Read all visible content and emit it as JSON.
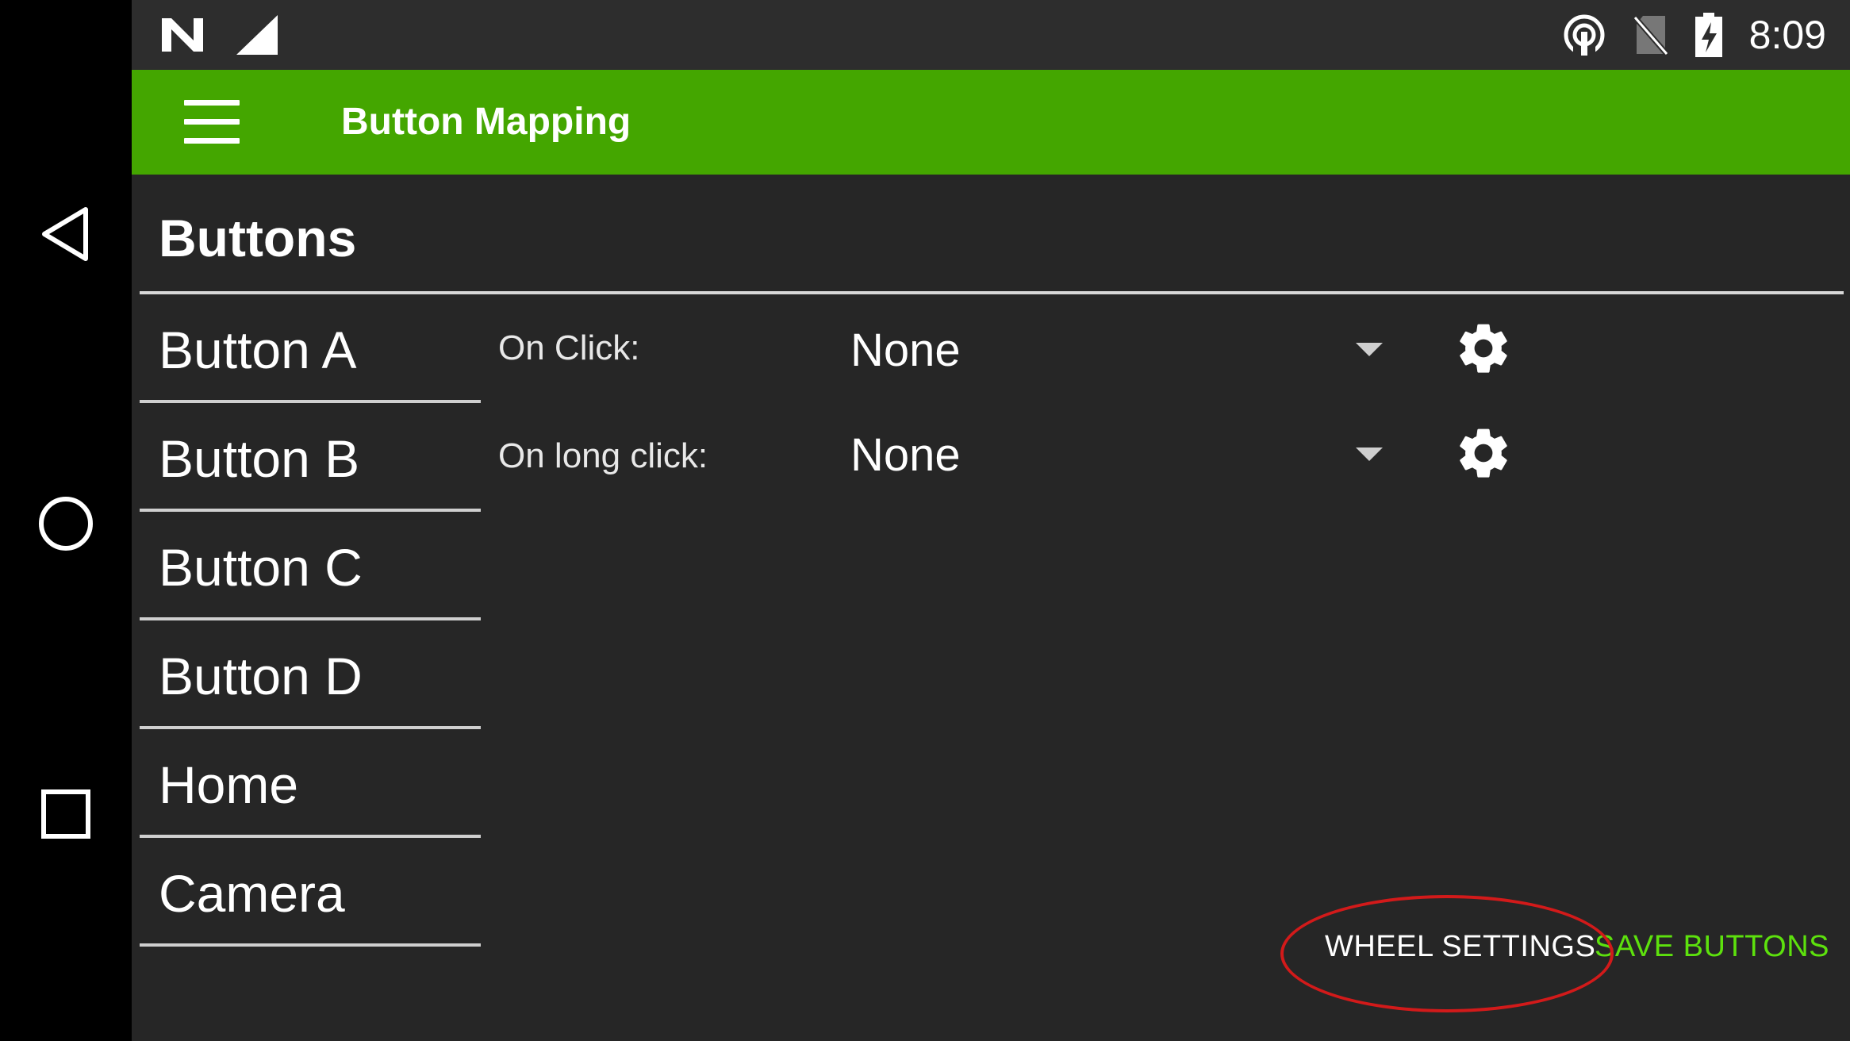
{
  "status_bar": {
    "time": "8:09",
    "icons": [
      "notification-n-icon",
      "signal-icon",
      "hotspot-icon",
      "no-sim-icon",
      "battery-charging-icon"
    ]
  },
  "nav_bar": {
    "icons": [
      "back-icon",
      "home-icon",
      "recents-icon"
    ]
  },
  "app_bar": {
    "menu_icon": "hamburger-menu-icon",
    "title": "Button Mapping"
  },
  "section": {
    "title": "Buttons"
  },
  "button_list": [
    {
      "label": "Button A"
    },
    {
      "label": "Button B"
    },
    {
      "label": "Button C"
    },
    {
      "label": "Button D"
    },
    {
      "label": "Home"
    },
    {
      "label": "Camera"
    }
  ],
  "mapping": {
    "on_click": {
      "label": "On Click:",
      "value": "None"
    },
    "on_long_click": {
      "label": "On long click:",
      "value": "None"
    }
  },
  "actions": {
    "wheel_settings": "WHEEL SETTINGS",
    "save_buttons": "SAVE BUTTONS"
  },
  "colors": {
    "app_bar": "#44a600",
    "accent": "#5de10d",
    "annotation": "#d21a1a",
    "background": "#262626"
  }
}
